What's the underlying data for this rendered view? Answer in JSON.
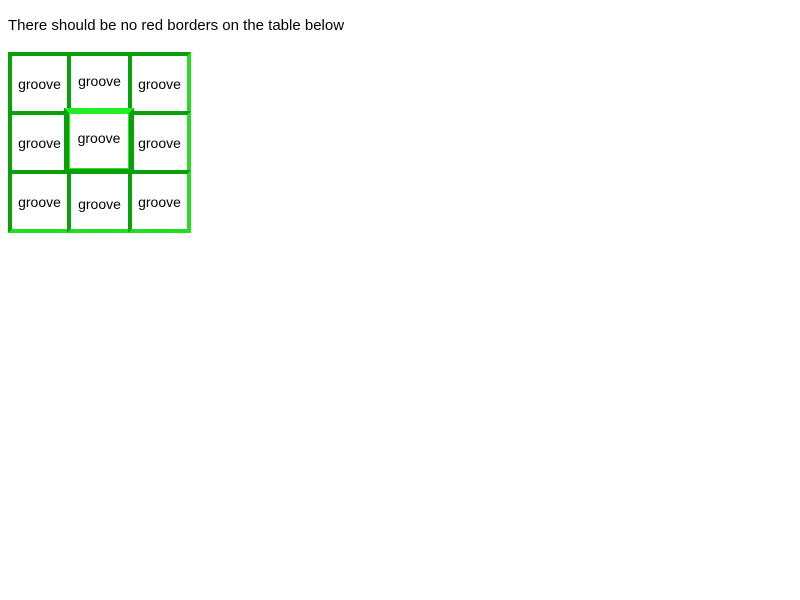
{
  "heading": "There should be no red borders on the table below",
  "table": {
    "rows": [
      [
        "groove",
        "groove",
        "groove"
      ],
      [
        "groove",
        "groove",
        "groove"
      ],
      [
        "groove",
        "groove",
        "groove"
      ]
    ]
  },
  "colors": {
    "border_dark": "#0aa00a",
    "border_light": "#22dd22",
    "border_bright": "#22ee22"
  }
}
